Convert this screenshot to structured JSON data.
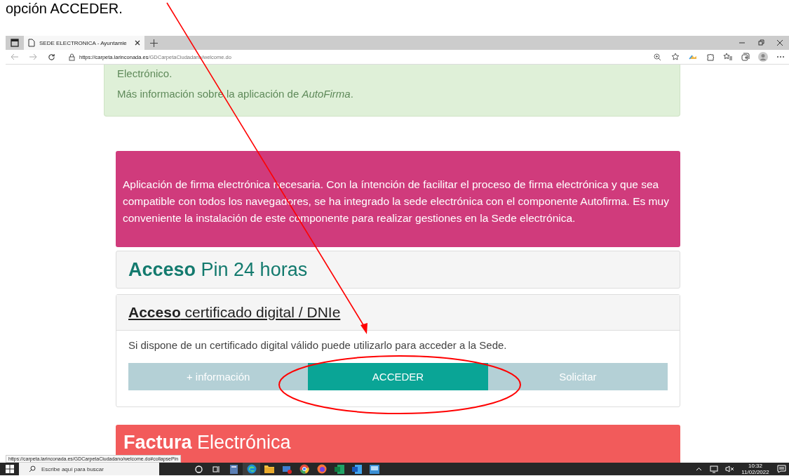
{
  "caption": "opción ACCEDER.",
  "browser": {
    "tab_title": "SEDE ELECTRONICA - Ayuntamie",
    "url_host": "https://carpeta.larinconada.es",
    "url_path": "/GDCarpetaCiudadano/welcome.do",
    "status_url": "https://carpeta.larinconada.es/GDCarpetaCiudadano/welcome.do#collapsePin"
  },
  "info_box": {
    "line": "Electrónico.",
    "more": "Más información sobre la aplicación de *AutoFirma*."
  },
  "alert": {
    "text": "Aplicación de firma electrónica necesaria. Con la íntención de facilitar el proceso de firma electrónica y que sea compatible con todos los navegadores, se ha integrado la sede electrónica con el componente Autofirma. Es muy conveniente la instalación de este componente para realizar gestiones en la Sede electrónica."
  },
  "pin_panel": {
    "title_bold": "Acceso",
    "title_rest": "Pin 24 horas"
  },
  "cert_panel": {
    "title_bold": "Acceso",
    "title_rest": "certificado digital / DNIe",
    "text": "Si dispone de un certificado digital válido puede utilizarlo para acceder a la Sede.",
    "buttons": [
      {
        "label": "+ información",
        "selected": false
      },
      {
        "label": "ACCEDER",
        "selected": true
      },
      {
        "label": "Solicitar",
        "selected": false
      }
    ]
  },
  "factura_panel": {
    "title_bold": "Factura",
    "title_rest": "Electrónica"
  },
  "taskbar": {
    "search_placeholder": "Escribe aquí para buscar",
    "time": "10:32",
    "date": "11/02/2022"
  }
}
